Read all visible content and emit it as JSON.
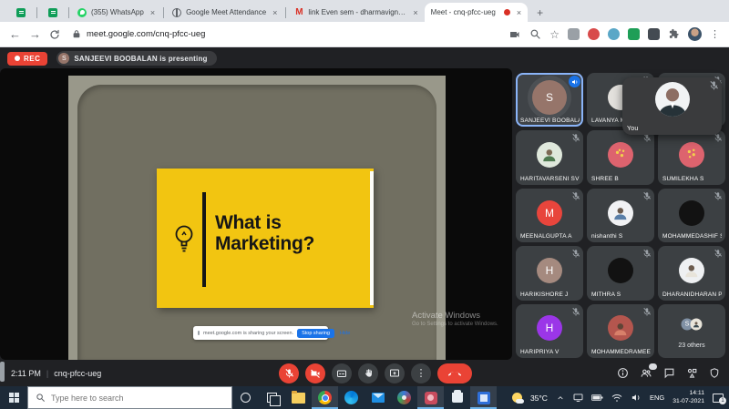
{
  "browser": {
    "tabs": {
      "whatsapp": {
        "title": "(355) WhatsApp"
      },
      "attendance": {
        "title": "Google Meet Attendance"
      },
      "gmail": {
        "title": "link Even sem - dharmavignesh"
      },
      "meet": {
        "title": "Meet - cnq-pfcc-ueg"
      }
    },
    "url": "meet.google.com/cnq-pfcc-ueg"
  },
  "meet": {
    "rec_label": "REC",
    "presenting_text": "SANJEEVI BOOBALAN is presenting",
    "presenter_initial": "S",
    "slide": {
      "line1": "What is",
      "line2": "Marketing?",
      "bg": "#f2c511"
    },
    "share_toast": {
      "message": "meet.google.com is sharing your screen.",
      "stop": "Stop sharing",
      "hide": "Hide"
    },
    "watermark": {
      "line1": "Activate Windows",
      "line2": "Go to Settings to activate Windows."
    },
    "you_label": "You",
    "bottom": {
      "time": "2:11 PM",
      "code": "cnq-pfcc-ueg"
    },
    "participants": [
      {
        "name": "SANJEEVI BOOBALAN",
        "letter": "S",
        "color": "#96756a",
        "speaking": true
      },
      {
        "name": "LAVANYA M",
        "letter": "",
        "color": "#e3e1dd"
      },
      {
        "name": "",
        "letter": "",
        "color": "#3c4043"
      },
      {
        "name": "HARITAVARSENI SV",
        "color": "#dfe8dc",
        "photo": true
      },
      {
        "name": "SHREE B",
        "color": "#dd636e",
        "photo": true
      },
      {
        "name": "SUMILEKHA S",
        "color": "#dd636e",
        "photo": true
      },
      {
        "name": "MEENALGUPTA A",
        "letter": "M",
        "color": "#e8453c"
      },
      {
        "name": "nishanthi S",
        "color": "#f1f2f4",
        "photo": true
      },
      {
        "name": "MOHAMMEDASHIF S",
        "letter": "",
        "color": "#121212"
      },
      {
        "name": "HARIKISHORE J",
        "letter": "H",
        "color": "#a58a7f"
      },
      {
        "name": "MITHRA S",
        "letter": "",
        "color": "#121212"
      },
      {
        "name": "DHARANIDHARAN P",
        "color": "#eef0f2",
        "photo": true
      },
      {
        "name": "HARIPRIYA V",
        "letter": "H",
        "color": "#9b36e8"
      },
      {
        "name": "MOHAMMEDRAMEE...",
        "color": "#b4564e",
        "photo": true
      },
      {
        "name": "23 others",
        "letter": "S",
        "color": "#8091a5"
      }
    ]
  },
  "taskbar": {
    "search_placeholder": "Type here to search",
    "weather": "35°C",
    "language": "ENG",
    "time": "14:11",
    "date": "31-07-2021",
    "notification_count": "1"
  }
}
